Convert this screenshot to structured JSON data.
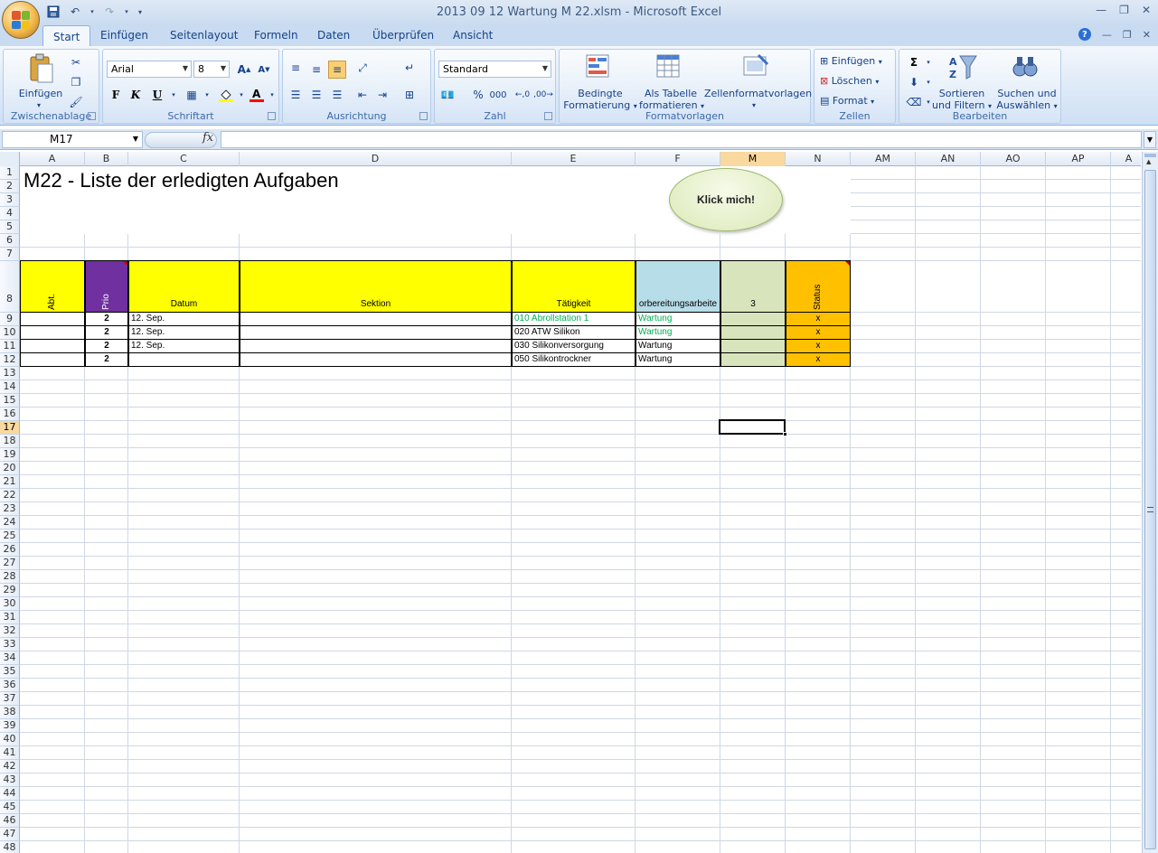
{
  "window": {
    "title": "2013 09 12 Wartung M 22.xlsm - Microsoft Excel"
  },
  "tabs": [
    "Start",
    "Einfügen",
    "Seitenlayout",
    "Formeln",
    "Daten",
    "Überprüfen",
    "Ansicht"
  ],
  "ribbon": {
    "clipboard": {
      "label": "Zwischenablage",
      "paste": "Einfügen"
    },
    "font": {
      "label": "Schriftart",
      "font_name": "Arial",
      "font_size": "8",
      "bold": "F",
      "italic": "K",
      "underline": "U"
    },
    "alignment": {
      "label": "Ausrichtung"
    },
    "number": {
      "label": "Zahl",
      "format": "Standard",
      "percent": "%",
      "thousands": "000"
    },
    "styles": {
      "label": "Formatvorlagen",
      "conditional_1": "Bedingte",
      "conditional_2": "Formatierung",
      "table_1": "Als Tabelle",
      "table_2": "formatieren",
      "cell_styles": "Zellenformatvorlagen"
    },
    "cells": {
      "label": "Zellen",
      "insert": "Einfügen",
      "delete": "Löschen",
      "format": "Format"
    },
    "editing": {
      "label": "Bearbeiten",
      "sort_1": "Sortieren",
      "sort_2": "und Filtern",
      "find_1": "Suchen und",
      "find_2": "Auswählen"
    }
  },
  "formula_bar": {
    "name_box": "M17",
    "fx": "fx",
    "formula": ""
  },
  "columns": [
    "A",
    "B",
    "C",
    "D",
    "E",
    "F",
    "M",
    "N",
    "AM",
    "AN",
    "AO",
    "AP",
    "A"
  ],
  "selected_column": "M",
  "selected_row": "17",
  "rows": [
    "1",
    "2",
    "3",
    "4",
    "5",
    "6",
    "7",
    "8",
    "9",
    "10",
    "11",
    "12",
    "13",
    "14",
    "15",
    "16",
    "17",
    "18",
    "19",
    "20",
    "21",
    "22",
    "23",
    "24",
    "25",
    "26",
    "27",
    "28",
    "29",
    "30",
    "31",
    "32",
    "33",
    "34",
    "35",
    "36",
    "37",
    "38",
    "39",
    "40",
    "41",
    "42",
    "43",
    "44",
    "45",
    "46",
    "47",
    "48"
  ],
  "sheet": {
    "title": "M22 - Liste der erledigten Aufgaben",
    "button": "Klick mich!",
    "headers": {
      "abt": "Abt.",
      "prio": "Prio",
      "datum": "Datum",
      "sektion": "Sektion",
      "taetigkeit": "Tätigkeit",
      "vorb": "orbereitungsarbeite",
      "m": "3",
      "status": "Status"
    },
    "data_rows": [
      {
        "prio": "2",
        "datum": "12. Sep.",
        "sektion": "",
        "taetigkeit": "010 Abrollstation 1",
        "vorb": "Wartung",
        "status": "x"
      },
      {
        "prio": "2",
        "datum": "12. Sep.",
        "sektion": "",
        "taetigkeit": "020 ATW Silikon",
        "vorb": "Wartung",
        "status": "x"
      },
      {
        "prio": "2",
        "datum": "12. Sep.",
        "sektion": "",
        "taetigkeit": "030 Silikonversorgung",
        "vorb": "Wartung",
        "status": "x"
      },
      {
        "prio": "2",
        "datum": "",
        "sektion": "",
        "taetigkeit": "050 Silikontrockner",
        "vorb": "Wartung",
        "status": "x"
      }
    ]
  },
  "colors": {
    "header_yellow": "#ffff00",
    "prio_purple": "#7030a0",
    "vorb_blue": "#b7dde8",
    "m_green": "#d8e4bc",
    "status_orange": "#ffc000",
    "green_text": "#00b050"
  }
}
